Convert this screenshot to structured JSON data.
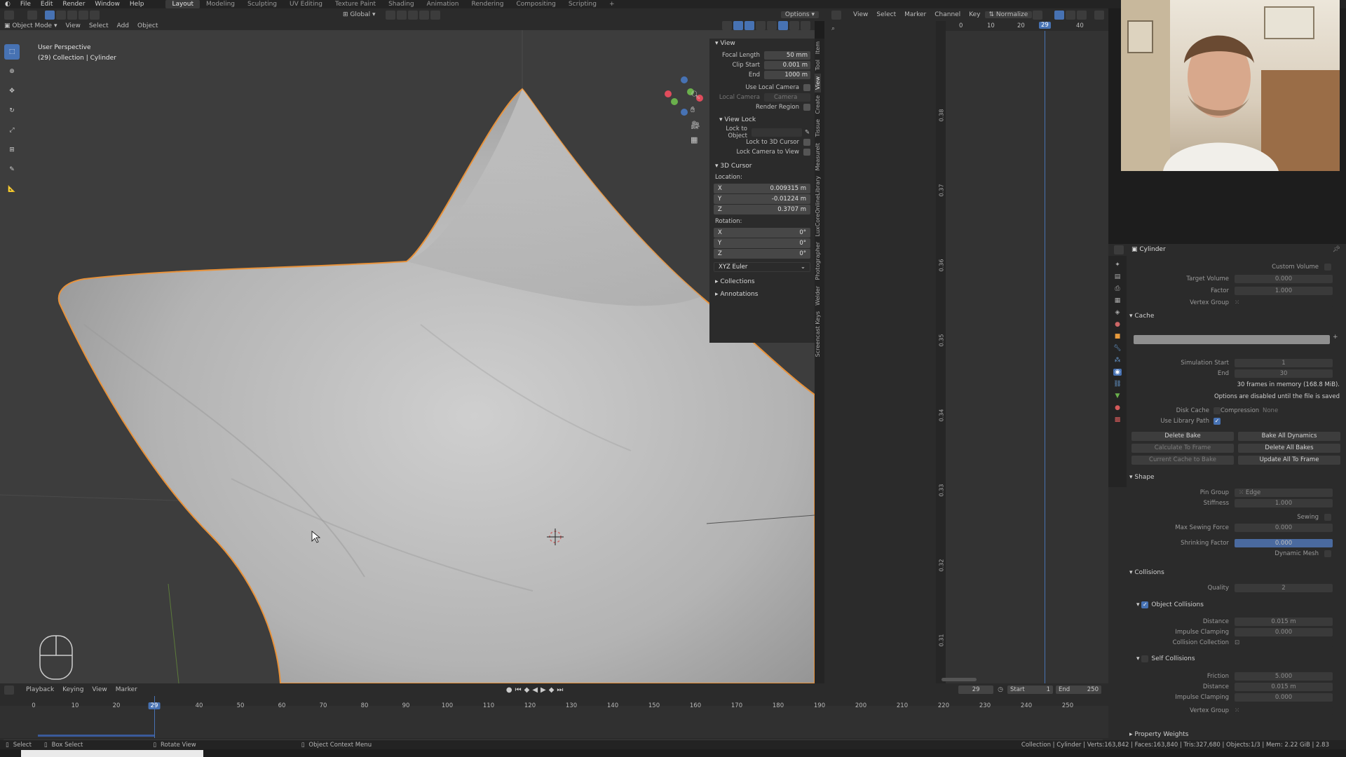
{
  "topbar": {
    "menus": [
      "File",
      "Edit",
      "Render",
      "Window",
      "Help"
    ],
    "workspaces": [
      "Layout",
      "Modeling",
      "Sculpting",
      "UV Editing",
      "Texture Paint",
      "Shading",
      "Animation",
      "Rendering",
      "Compositing",
      "Scripting",
      "+"
    ],
    "active_workspace": "Layout"
  },
  "viewport_header": {
    "transform": "Global",
    "options": "Options",
    "mode": "Object Mode",
    "menus": [
      "View",
      "Select",
      "Add",
      "Object"
    ]
  },
  "viewport": {
    "perspective": "User Perspective",
    "collection": "(29) Collection | Cylinder"
  },
  "n_panel": {
    "view_header": "View",
    "focal_length_label": "Focal Length",
    "focal_length": "50 mm",
    "clip_start_label": "Clip Start",
    "clip_start": "0.001 m",
    "end_label": "End",
    "end": "1000 m",
    "use_local_camera": "Use Local Camera",
    "local_camera_label": "Local Camera",
    "local_camera_value": "Camera",
    "render_region": "Render Region",
    "view_lock_header": "View Lock",
    "lock_to_object": "Lock to Object",
    "lock_to_3d_cursor": "Lock to 3D Cursor",
    "lock_camera_to_view": "Lock Camera to View",
    "cursor_header": "3D Cursor",
    "location_label": "Location:",
    "loc_x_label": "X",
    "loc_x": "0.009315 m",
    "loc_y_label": "Y",
    "loc_y": "-0.01224 m",
    "loc_z_label": "Z",
    "loc_z": "0.3707 m",
    "rotation_label": "Rotation:",
    "rot_x_label": "X",
    "rot_x": "0°",
    "rot_y_label": "Y",
    "rot_y": "0°",
    "rot_z_label": "Z",
    "rot_z": "0°",
    "rotation_mode": "XYZ Euler",
    "collections": "Collections",
    "annotations": "Annotations"
  },
  "side_tabs": [
    "Item",
    "Tool",
    "View",
    "Create",
    "Tissue",
    "MeasureIt",
    "LuxCoreOnlineLibrary",
    "Photographer",
    "Welder",
    "Screencast Keys"
  ],
  "graph_editor": {
    "menus": [
      "View",
      "Select",
      "Marker",
      "Channel",
      "Key"
    ],
    "normalize": "Normalize",
    "frame_ticks": [
      "0",
      "10",
      "20",
      "29",
      "40"
    ],
    "value_ticks": [
      "0.38",
      "0.37",
      "0.36",
      "0.35",
      "0.34",
      "0.33",
      "0.32",
      "0.31"
    ]
  },
  "properties": {
    "object_name": "Cylinder",
    "custom_volume": "Custom Volume",
    "target_volume_label": "Target Volume",
    "target_volume": "0.000",
    "factor_label": "Factor",
    "factor": "1.000",
    "vertex_group_label": "Vertex Group",
    "cache_header": "Cache",
    "sim_start_label": "Simulation Start",
    "sim_start": "1",
    "sim_end_label": "End",
    "sim_end": "30",
    "memory_info": "30 frames in memory (168.8 MiB).",
    "options_disabled": "Options are disabled until the file is saved",
    "disk_cache": "Disk Cache",
    "compression_label": "Compression",
    "compression": "None",
    "use_library_path": "Use Library Path",
    "delete_bake": "Delete Bake",
    "bake_all_dynamics": "Bake All Dynamics",
    "calculate_to_frame": "Calculate To Frame",
    "delete_all_bakes": "Delete All Bakes",
    "current_cache_to_bake": "Current Cache to Bake",
    "update_all_to_frame": "Update All To Frame",
    "shape_header": "Shape",
    "pin_group_label": "Pin Group",
    "pin_group": "Edge",
    "stiffness_label": "Stiffness",
    "stiffness": "1.000",
    "sewing_label": "Sewing",
    "max_sewing_label": "Max Sewing Force",
    "max_sewing": "0.000",
    "shrinking_label": "Shrinking Factor",
    "shrinking": "0.000",
    "dynamic_mesh_label": "Dynamic Mesh",
    "collisions_header": "Collisions",
    "quality_label": "Quality",
    "quality": "2",
    "object_collisions": "Object Collisions",
    "distance_label": "Distance",
    "distance": "0.015 m",
    "impulse_label": "Impulse Clamping",
    "impulse": "0.000",
    "collision_collection_label": "Collision Collection",
    "self_collisions": "Self Collisions",
    "friction_label": "Friction",
    "friction": "5.000",
    "self_distance_label": "Distance",
    "self_distance": "0.015 m",
    "self_impulse_label": "Impulse Clamping",
    "self_impulse": "0.000",
    "self_vertex_group_label": "Vertex Group",
    "property_weights": "Property Weights"
  },
  "timeline": {
    "menus": [
      "Playback",
      "Keying",
      "View",
      "Marker"
    ],
    "current_frame": "29",
    "start_label": "Start",
    "start": "1",
    "end_label": "End",
    "end": "250",
    "ticks": [
      "0",
      "10",
      "20",
      "29",
      "40",
      "50",
      "60",
      "70",
      "80",
      "90",
      "100",
      "110",
      "120",
      "130",
      "140",
      "150",
      "160",
      "170",
      "180",
      "190",
      "200",
      "210",
      "220",
      "230",
      "240",
      "250"
    ]
  },
  "statusbar": {
    "select": "Select",
    "box_select": "Box Select",
    "rotate_view": "Rotate View",
    "context_menu": "Object Context Menu",
    "stats": "Collection | Cylinder | Verts:163,842 | Faces:163,840 | Tris:327,680 | Objects:1/3 | Mem: 2.22 GiB | 2.83"
  },
  "colors": {
    "accent_blue": "#4772b3",
    "selection_orange": "#f0a040",
    "mesh_gray": "#b9b9b9"
  }
}
